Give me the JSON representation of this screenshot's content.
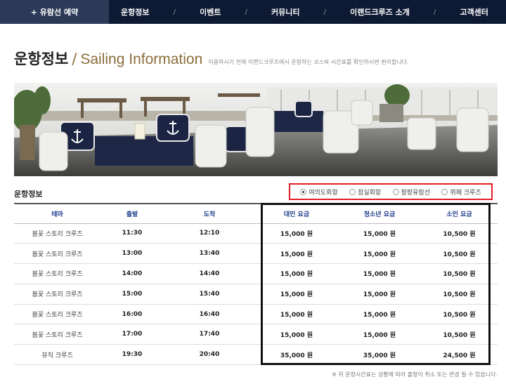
{
  "nav": {
    "reserve_label": "+ 유람선 예약",
    "items": [
      "운항정보",
      "이벤트",
      "커뮤니티",
      "이랜드크루즈 소개",
      "고객센터"
    ],
    "separator": "/"
  },
  "page": {
    "title_ko": "운항정보",
    "title_slash": "/",
    "title_en": "Sailing Information",
    "description": "이용하시기 전에 이랜드크루즈에서 운항하는 코스와 시간표를 확인하시면 편리합니다."
  },
  "section": {
    "title": "운항정보",
    "routes": [
      {
        "label": "여의도회항",
        "selected": true
      },
      {
        "label": "잠실회항",
        "selected": false
      },
      {
        "label": "팡팡유람선",
        "selected": false
      },
      {
        "label": "뷔페 크루즈",
        "selected": false
      }
    ]
  },
  "table": {
    "headers": [
      "테마",
      "출발",
      "도착",
      "대인 요금",
      "청소년 요금",
      "소인 요금"
    ],
    "rows": [
      [
        "봄꽃 스토리 크루즈",
        "11:30",
        "12:10",
        "15,000 원",
        "15,000 원",
        "10,500 원"
      ],
      [
        "봄꽃 스토리 크루즈",
        "13:00",
        "13:40",
        "15,000 원",
        "15,000 원",
        "10,500 원"
      ],
      [
        "봄꽃 스토리 크루즈",
        "14:00",
        "14:40",
        "15,000 원",
        "15,000 원",
        "10,500 원"
      ],
      [
        "봄꽃 스토리 크루즈",
        "15:00",
        "15:40",
        "15,000 원",
        "15,000 원",
        "10,500 원"
      ],
      [
        "봄꽃 스토리 크루즈",
        "16:00",
        "16:40",
        "15,000 원",
        "15,000 원",
        "10,500 원"
      ],
      [
        "봄꽃 스토리 크루즈",
        "17:00",
        "17:40",
        "15,000 원",
        "15,000 원",
        "10,500 원"
      ],
      [
        "뮤직 크루즈",
        "19:30",
        "20:40",
        "35,000 원",
        "35,000 원",
        "24,500 원"
      ]
    ]
  },
  "footnote": "※ 위 운항시간표는 상황에 따라 출항이 취소 또는 변경 될 수 있습니다.",
  "colors": {
    "nav_bg": "#0e1a33",
    "reserve_bg": "#2c3a57",
    "title_accent": "#8a6d3b",
    "header_text": "#1c3c8a",
    "highlight_red": "#e31c23",
    "highlight_black": "#111111"
  }
}
